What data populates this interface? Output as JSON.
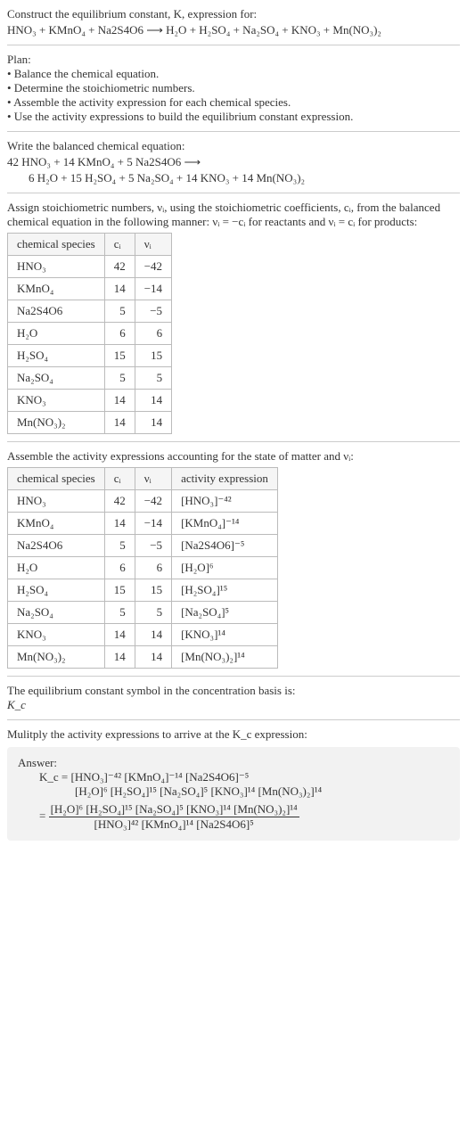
{
  "intro": {
    "line1": "Construct the equilibrium constant, K, expression for:",
    "equation": "HNO₃ + KMnO₄ + Na2S4O6 ⟶ H₂O + H₂SO₄ + Na₂SO₄ + KNO₃ + Mn(NO₃)₂"
  },
  "plan": {
    "heading": "Plan:",
    "items": [
      "• Balance the chemical equation.",
      "• Determine the stoichiometric numbers.",
      "• Assemble the activity expression for each chemical species.",
      "• Use the activity expressions to build the equilibrium constant expression."
    ]
  },
  "balanced": {
    "heading": "Write the balanced chemical equation:",
    "line1": "42 HNO₃ + 14 KMnO₄ + 5 Na2S4O6 ⟶",
    "line2": "6 H₂O + 15 H₂SO₄ + 5 Na₂SO₄ + 14 KNO₃ + 14 Mn(NO₃)₂"
  },
  "assign": {
    "text": "Assign stoichiometric numbers, νᵢ, using the stoichiometric coefficients, cᵢ, from the balanced chemical equation in the following manner: νᵢ = −cᵢ for reactants and νᵢ = cᵢ for products:"
  },
  "table1": {
    "headers": [
      "chemical species",
      "cᵢ",
      "νᵢ"
    ],
    "rows": [
      [
        "HNO₃",
        "42",
        "−42"
      ],
      [
        "KMnO₄",
        "14",
        "−14"
      ],
      [
        "Na2S4O6",
        "5",
        "−5"
      ],
      [
        "H₂O",
        "6",
        "6"
      ],
      [
        "H₂SO₄",
        "15",
        "15"
      ],
      [
        "Na₂SO₄",
        "5",
        "5"
      ],
      [
        "KNO₃",
        "14",
        "14"
      ],
      [
        "Mn(NO₃)₂",
        "14",
        "14"
      ]
    ]
  },
  "assemble": {
    "text": "Assemble the activity expressions accounting for the state of matter and νᵢ:"
  },
  "table2": {
    "headers": [
      "chemical species",
      "cᵢ",
      "νᵢ",
      "activity expression"
    ],
    "rows": [
      [
        "HNO₃",
        "42",
        "−42",
        "[HNO₃]⁻⁴²"
      ],
      [
        "KMnO₄",
        "14",
        "−14",
        "[KMnO₄]⁻¹⁴"
      ],
      [
        "Na2S4O6",
        "5",
        "−5",
        "[Na2S4O6]⁻⁵"
      ],
      [
        "H₂O",
        "6",
        "6",
        "[H₂O]⁶"
      ],
      [
        "H₂SO₄",
        "15",
        "15",
        "[H₂SO₄]¹⁵"
      ],
      [
        "Na₂SO₄",
        "5",
        "5",
        "[Na₂SO₄]⁵"
      ],
      [
        "KNO₃",
        "14",
        "14",
        "[KNO₃]¹⁴"
      ],
      [
        "Mn(NO₃)₂",
        "14",
        "14",
        "[Mn(NO₃)₂]¹⁴"
      ]
    ]
  },
  "eqconst": {
    "line1": "The equilibrium constant symbol in the concentration basis is:",
    "line2": "K_c"
  },
  "multiply": {
    "text": "Mulitply the activity expressions to arrive at the K_c expression:"
  },
  "answer": {
    "label": "Answer:",
    "l1": "K_c = [HNO₃]⁻⁴² [KMnO₄]⁻¹⁴ [Na2S4O6]⁻⁵",
    "l2": "[H₂O]⁶ [H₂SO₄]¹⁵ [Na₂SO₄]⁵ [KNO₃]¹⁴ [Mn(NO₃)₂]¹⁴",
    "frac_num": "[H₂O]⁶ [H₂SO₄]¹⁵ [Na₂SO₄]⁵ [KNO₃]¹⁴ [Mn(NO₃)₂]¹⁴",
    "frac_den": "[HNO₃]⁴² [KMnO₄]¹⁴ [Na2S4O6]⁵",
    "eq_sign": "="
  }
}
